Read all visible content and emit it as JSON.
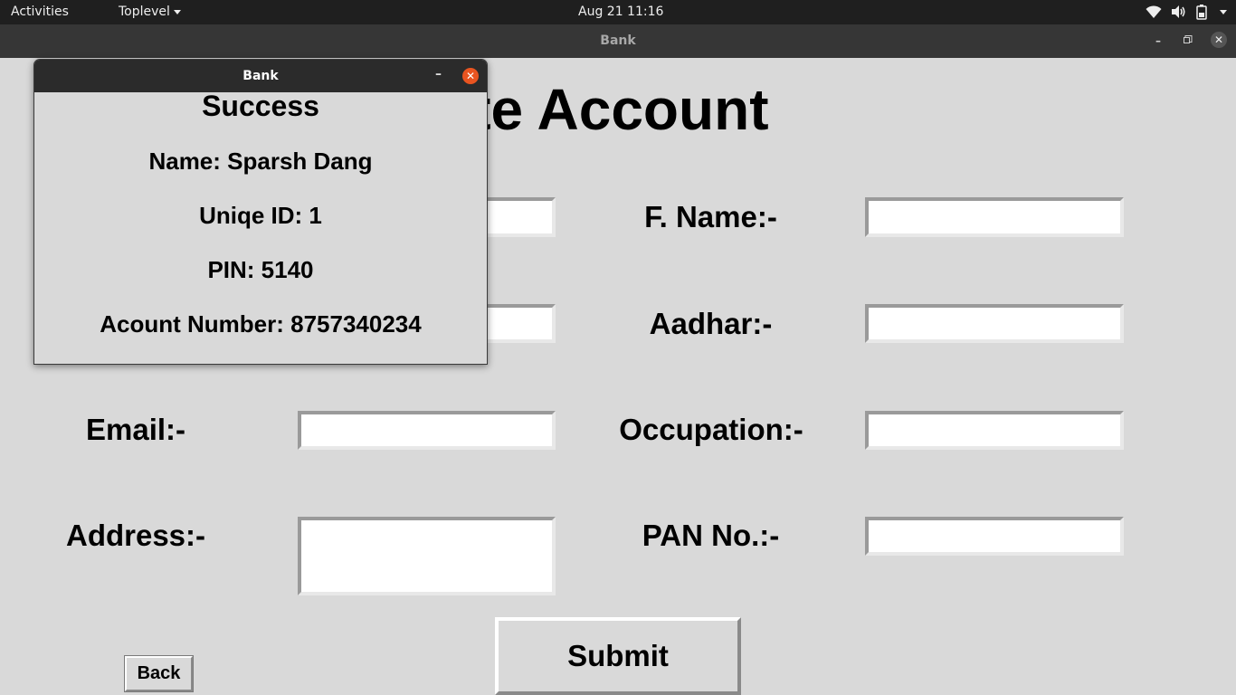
{
  "topbar": {
    "activities": "Activities",
    "app_menu": "Toplevel",
    "clock": "Aug 21  11:16",
    "icons": [
      "wifi-icon",
      "volume-icon",
      "battery-icon",
      "chevron-down-icon"
    ]
  },
  "main_window": {
    "title": "Bank",
    "controls": [
      "minimize-icon",
      "maximize-icon",
      "close-icon"
    ]
  },
  "form": {
    "heading": "eate Account",
    "labels": {
      "fname": "F. Name:-",
      "aadhar": "Aadhar:-",
      "email": "Email:-",
      "occupation": "Occupation:-",
      "address": "Address:-",
      "pan": "PAN No.:-"
    },
    "fields": {
      "name": "",
      "fname": "",
      "phone": "",
      "aadhar": "",
      "email": "",
      "occupation": "",
      "address": "",
      "pan": ""
    },
    "submit_label": "Submit",
    "back_label": "Back"
  },
  "dialog": {
    "title": "Bank",
    "heading": "Success",
    "name_line": "Name: Sparsh Dang",
    "id_line": "Uniqe ID: 1",
    "pin_line": "PIN: 5140",
    "account_line": "Acount Number: 8757340234"
  },
  "colors": {
    "background": "#d9d9d9",
    "topbar": "#1f1f1f",
    "titlebar": "#363636",
    "dialog_titlebar": "#2b2b2b",
    "dialog_close": "#e95420"
  }
}
